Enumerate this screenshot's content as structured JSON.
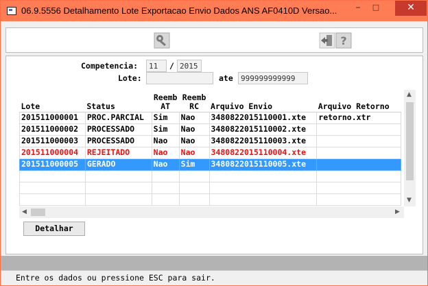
{
  "window": {
    "title": "06.9.5556 Detalhamento Lote Exportacao Envio Dados ANS AF0410D Versao...",
    "minimize_label": "–",
    "maximize_label": "□",
    "close_label": "✕"
  },
  "toolbar": {
    "icons": [
      "key-icon",
      "exit-icon",
      "help-icon"
    ]
  },
  "form": {
    "competencia_label": "Competencia:",
    "competencia_month": "11",
    "separator": "/",
    "competencia_year": "2015",
    "lote_label": "Lote:",
    "lote_from": "",
    "ate_label": "ate",
    "lote_to": "999999999999"
  },
  "grid": {
    "headers": {
      "lote": "Lote",
      "status": "Status",
      "reemb_at_1": "Reemb",
      "reemb_at_2": "AT",
      "reemb_rc_1": "Reemb",
      "reemb_rc_2": "RC",
      "arquivo_envio": "Arquivo Envio",
      "arquivo_retorno": "Arquivo Retorno"
    },
    "rows": [
      {
        "lote": "201511000001",
        "status": "PROC.PARCIAL",
        "at": "Sim",
        "rc": "Nao",
        "envio": "3480822015110001.xte",
        "retorno": "retorno.xtr"
      },
      {
        "lote": "201511000002",
        "status": "PROCESSADO",
        "at": "Sim",
        "rc": "Nao",
        "envio": "3480822015110002.xte",
        "retorno": ""
      },
      {
        "lote": "201511000003",
        "status": "PROCESSADO",
        "at": "Nao",
        "rc": "Nao",
        "envio": "3480822015110003.xte",
        "retorno": ""
      },
      {
        "lote": "201511000004",
        "status": "REJEITADO",
        "at": "Nao",
        "rc": "Nao",
        "envio": "3480822015110004.xte",
        "retorno": ""
      },
      {
        "lote": "201511000005",
        "status": "GERADO",
        "at": "Nao",
        "rc": "Sim",
        "envio": "3480822015110005.xte",
        "retorno": ""
      }
    ],
    "selected_row": 5,
    "rejected_color": "#e81313",
    "selected_color": "#3399ff"
  },
  "buttons": {
    "detalhar": "Detalhar"
  },
  "status_bar": {
    "text": "Entre os dados ou pressione ESC para sair."
  }
}
